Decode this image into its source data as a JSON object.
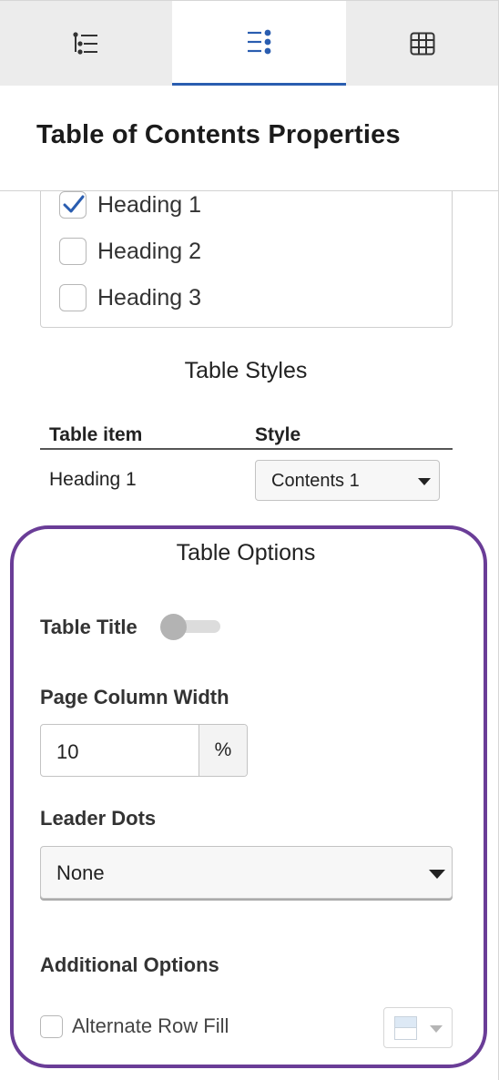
{
  "tabs": [
    {
      "icon": "outline-list-icon",
      "active": false
    },
    {
      "icon": "numbered-list-icon",
      "active": true
    },
    {
      "icon": "table-grid-icon",
      "active": false
    }
  ],
  "colors": {
    "active_tab_underline": "#2a5db0",
    "checkmark": "#2a5db0",
    "highlight_frame": "#6a3d97"
  },
  "header": {
    "title": "Table of Contents Properties"
  },
  "headings": [
    {
      "label": "Heading 1",
      "checked": true
    },
    {
      "label": "Heading 2",
      "checked": false
    },
    {
      "label": "Heading 3",
      "checked": false
    }
  ],
  "table_styles": {
    "title": "Table Styles",
    "col_item": "Table item",
    "col_style": "Style",
    "rows": [
      {
        "item": "Heading 1",
        "style": "Contents 1"
      }
    ]
  },
  "table_options": {
    "title": "Table Options",
    "table_title_label": "Table Title",
    "table_title_on": false,
    "page_column_width_label": "Page Column Width",
    "page_column_width_value": "10",
    "page_column_width_unit": "%",
    "leader_dots_label": "Leader Dots",
    "leader_dots_value": "None",
    "additional_options_label": "Additional Options",
    "alternate_row_fill_label": "Alternate Row Fill",
    "alternate_row_fill_checked": false
  }
}
